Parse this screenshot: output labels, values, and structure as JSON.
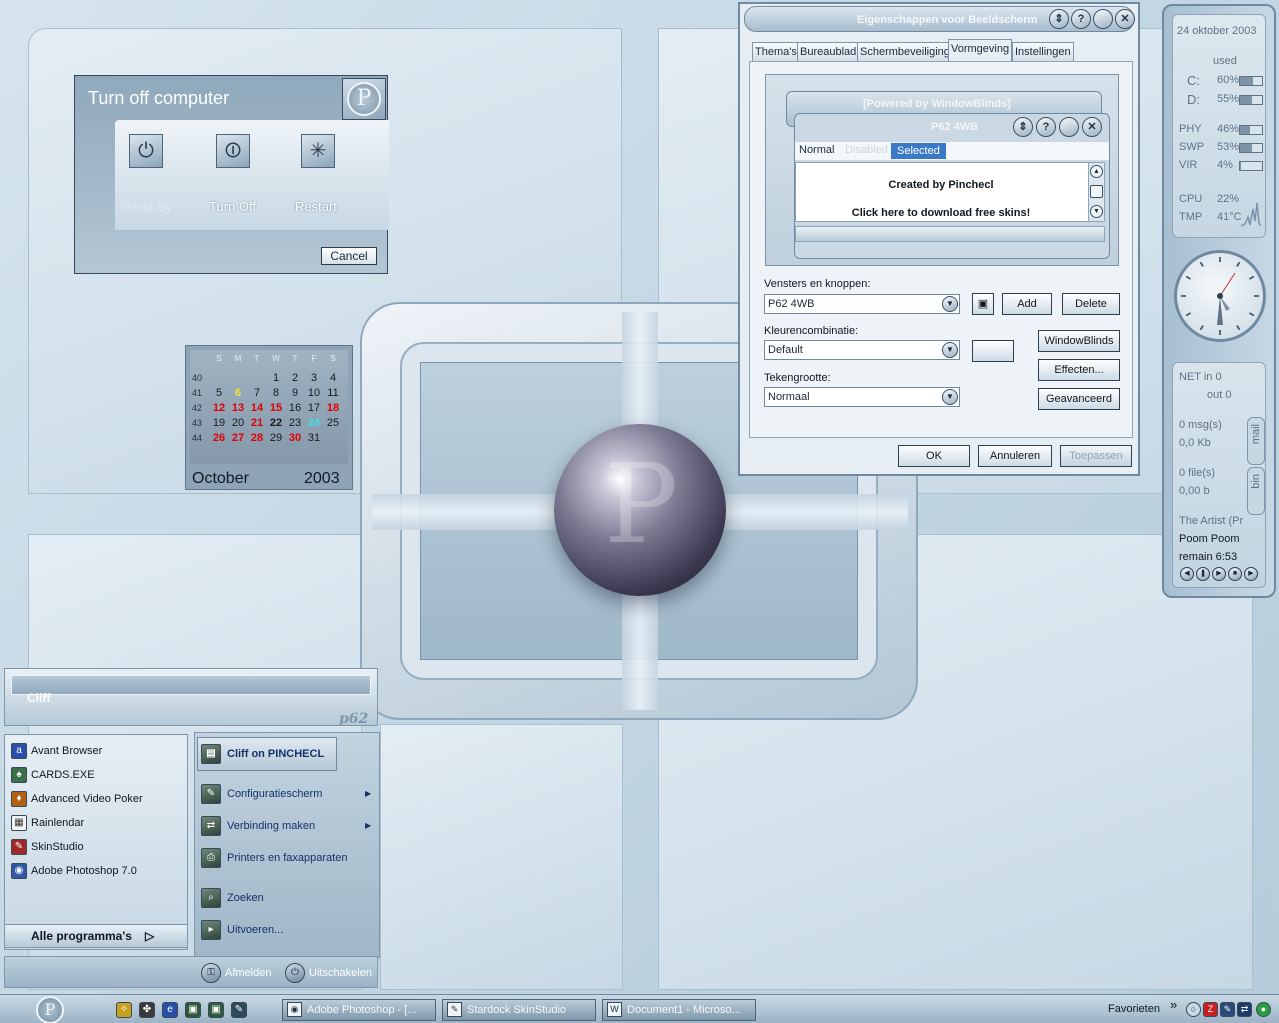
{
  "turn_off_dialog": {
    "title": "Turn off computer",
    "logo_letter": "P",
    "standby_label": "Stand By",
    "turnoff_label": "Turn Off",
    "restart_label": "Restart",
    "cancel_label": "Cancel"
  },
  "calendar": {
    "weekday_headers": [
      "S",
      "M",
      "T",
      "W",
      "T",
      "F",
      "S"
    ],
    "week_numbers": [
      "40",
      "41",
      "42",
      "43",
      "44"
    ],
    "weeks": [
      [
        "",
        "",
        "",
        "1",
        "2",
        "3",
        "4"
      ],
      [
        "5",
        "6",
        "7",
        "8",
        "9",
        "10",
        "11"
      ],
      [
        "12",
        "13",
        "14",
        "15",
        "16",
        "17",
        "18"
      ],
      [
        "19",
        "20",
        "21",
        "22",
        "23",
        "24",
        "25"
      ],
      [
        "26",
        "27",
        "28",
        "29",
        "30",
        "31",
        ""
      ]
    ],
    "month": "October",
    "year": "2003",
    "today": "6",
    "selected": "24"
  },
  "display_properties": {
    "title": "Eigenschappen voor Beeldscherm",
    "tabs": [
      "Thema's",
      "Bureaublad",
      "Schermbeveiliging",
      "Vormgeving",
      "Instellingen"
    ],
    "active_tab": "Vormgeving",
    "preview": {
      "inactive_title": "[Powered by WindowBlinds]",
      "active_title": "P62 4WB",
      "tab_normal": "Normal",
      "tab_disabled": "Disabled",
      "tab_selected": "Selected",
      "line1": "Created by Pinchecl",
      "line2": "Click here to download free skins!"
    },
    "windows_buttons_label": "Vensters en knoppen:",
    "windows_buttons_value": "P62 4WB",
    "add_label": "Add",
    "delete_label": "Delete",
    "color_scheme_label": "Kleurencombinatie:",
    "color_scheme_value": "Default",
    "font_size_label": "Tekengrootte:",
    "font_size_value": "Normaal",
    "windowblinds_label": "WindowBlinds",
    "effects_label": "Effecten...",
    "advanced_label": "Geavanceerd",
    "ok_label": "OK",
    "cancel_label": "Annuleren",
    "apply_label": "Toepassen"
  },
  "sidebar": {
    "date": "24 oktober 2003",
    "used_label": "used",
    "drives": [
      {
        "label": "C:",
        "value": "60%",
        "fill": 0.6
      },
      {
        "label": "D:",
        "value": "55%",
        "fill": 0.55
      }
    ],
    "memory": [
      {
        "label": "PHY",
        "value": "46%",
        "fill": 0.46
      },
      {
        "label": "SWP",
        "value": "53%",
        "fill": 0.53
      },
      {
        "label": "VIR",
        "value": "4%",
        "fill": 0.04
      }
    ],
    "cpu_label": "CPU",
    "cpu_value": "22%",
    "tmp_label": "TMP",
    "tmp_value": "41°C",
    "net_in": "NET in 0",
    "net_out": "out 0",
    "msgs": "0 msg(s)",
    "msg_size": "0,0 Kb",
    "files": "0 file(s)",
    "file_size": "0,00 b",
    "mail_tab": "mail",
    "bin_tab": "bin",
    "artist": "The Artist (Pr",
    "track": "Poom Poom",
    "remain": "remain 6:53"
  },
  "start_menu": {
    "user": "Cliff",
    "brand": "p62",
    "programs": [
      "Avant Browser",
      "CARDS.EXE",
      "Advanced Video Poker",
      "Rainlendar",
      "SkinStudio",
      "Adobe Photoshop 7.0"
    ],
    "all_programs": "Alle programma's",
    "right_items": {
      "owner": "Cliff on PINCHECL",
      "control_panel": "Configuratiescherm",
      "connect": "Verbinding maken",
      "printers": "Printers en faxapparaten",
      "search": "Zoeken",
      "run": "Uitvoeren..."
    },
    "logoff": "Afmelden",
    "shutdown": "Uitschakelen"
  },
  "taskbar": {
    "start_letter": "P",
    "tasks": [
      "Adobe Photoshop - [...",
      "Stardock SkinStudio",
      "Document1 - Microso..."
    ],
    "favorites": "Favorieten",
    "chevron": "»"
  }
}
